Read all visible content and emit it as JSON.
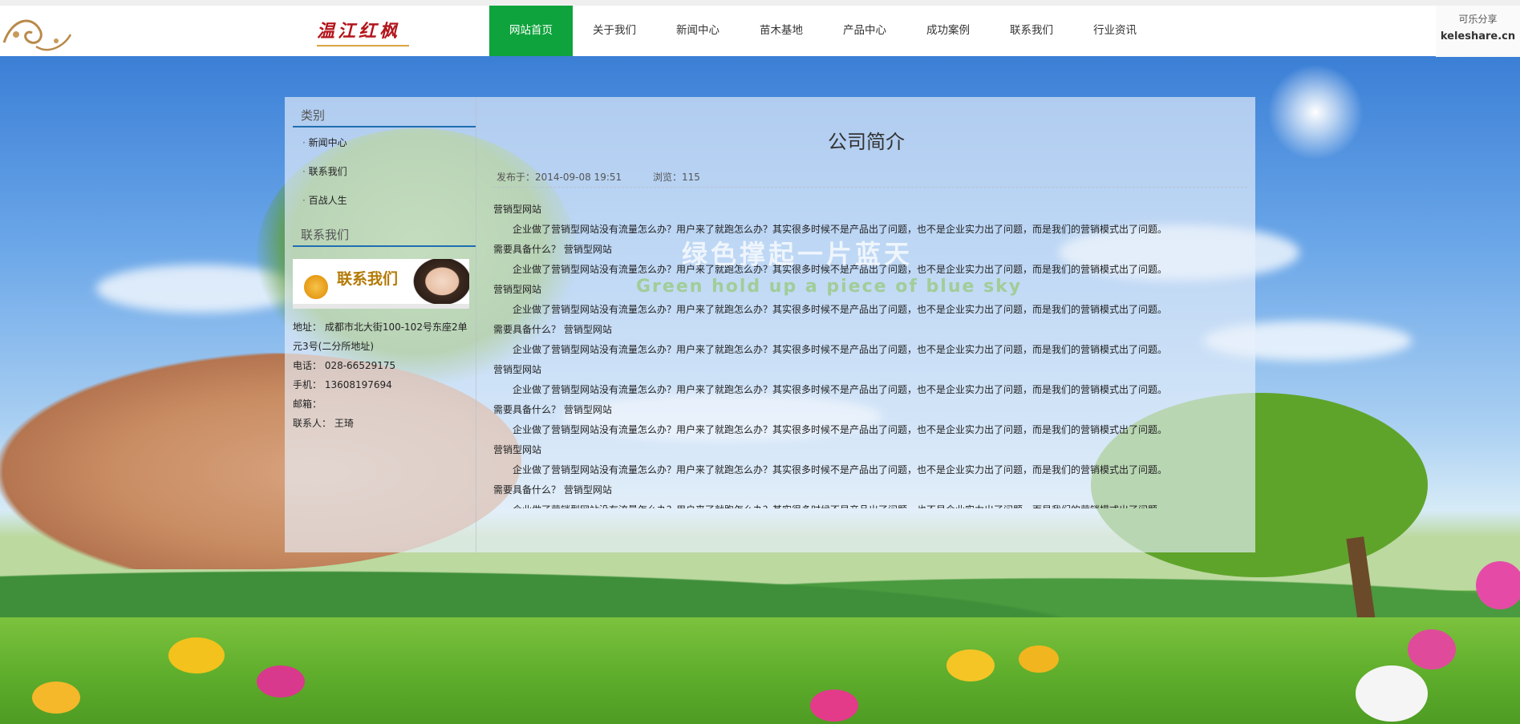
{
  "header": {
    "logo_text": "温江红枫",
    "nav": [
      {
        "label": "网站首页",
        "active": true
      },
      {
        "label": "关于我们",
        "active": false
      },
      {
        "label": "新闻中心",
        "active": false
      },
      {
        "label": "苗木基地",
        "active": false
      },
      {
        "label": "产品中心",
        "active": false
      },
      {
        "label": "成功案例",
        "active": false
      },
      {
        "label": "联系我们",
        "active": false
      },
      {
        "label": "行业资讯",
        "active": false
      }
    ],
    "share_title": "可乐分享",
    "share_site": "keleshare.cn"
  },
  "sidebar": {
    "category_title": "类别",
    "categories": [
      "新闻中心",
      "联系我们",
      "百战人生"
    ],
    "contact_title": "联系我们",
    "banner_text": "联系我们",
    "contact": {
      "address": "地址： 成都市北大街100-102号东座2单元3号(二分所地址)",
      "phone": "电话： 028-66529175",
      "mobile": "手机： 13608197694",
      "email": "邮箱：",
      "person": "联系人： 王琦"
    }
  },
  "article": {
    "title": "公司简介",
    "publish": "发布于：2014-09-08 19:51",
    "views": "浏览：115",
    "heading_a": "营销型网站",
    "heading_b": "需要具备什么？ 营销型网站",
    "paragraph": "企业做了营销型网站没有流量怎么办？用户来了就跑怎么办？其实很多时候不是产品出了问题，也不是企业实力出了问题，而是我们的营销模式出了问题。"
  },
  "watermark": {
    "cn": "绿色撑起一片蓝天",
    "en": "Green hold up a piece of blue sky"
  },
  "colors": {
    "nav_active": "#0ea33c",
    "side_rule": "#1f6eb0",
    "logo": "#b3151b"
  }
}
